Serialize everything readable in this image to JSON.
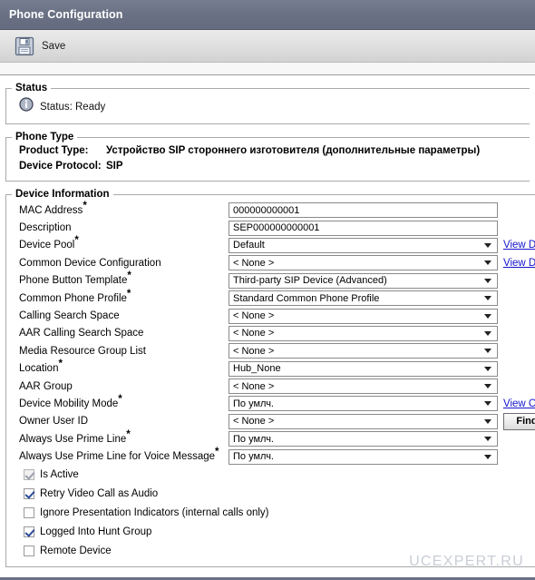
{
  "window": {
    "title": "Phone Configuration"
  },
  "toolbar": {
    "save_label": "Save",
    "save_icon": "floppy-disk-icon"
  },
  "status": {
    "legend": "Status",
    "icon": "info-icon",
    "text": "Status: Ready"
  },
  "phone_type": {
    "legend": "Phone Type",
    "rows": [
      {
        "key": "Product Type:",
        "value": "Устройство SIP стороннего изготовителя (дополнительные параметры)"
      },
      {
        "key": "Device Protocol:",
        "value": "SIP"
      }
    ]
  },
  "device_information": {
    "legend": "Device Information",
    "fields": [
      {
        "label": "MAC Address",
        "required": true,
        "type": "text",
        "value": "000000000001"
      },
      {
        "label": "Description",
        "required": false,
        "type": "text",
        "value": "SEP000000000001"
      },
      {
        "label": "Device Pool",
        "required": true,
        "type": "select",
        "value": "Default",
        "link": "View Details"
      },
      {
        "label": "Common Device Configuration",
        "required": false,
        "type": "select",
        "value": "< None >",
        "link": "View Details"
      },
      {
        "label": "Phone Button Template",
        "required": true,
        "type": "select",
        "value": "Third-party SIP Device (Advanced)"
      },
      {
        "label": "Common Phone Profile",
        "required": true,
        "type": "select",
        "value": "Standard Common Phone Profile"
      },
      {
        "label": "Calling Search Space",
        "required": false,
        "type": "select",
        "value": "< None >"
      },
      {
        "label": "AAR Calling Search Space",
        "required": false,
        "type": "select",
        "value": "< None >"
      },
      {
        "label": "Media Resource Group List",
        "required": false,
        "type": "select",
        "value": "< None >"
      },
      {
        "label": "Location",
        "required": true,
        "type": "select",
        "value": "Hub_None"
      },
      {
        "label": "AAR Group",
        "required": false,
        "type": "select",
        "value": "< None >"
      },
      {
        "label": "Device Mobility Mode",
        "required": true,
        "type": "select",
        "value": "По умлч.",
        "link": "View Current Device Mobility Settings"
      },
      {
        "label": "Owner User ID",
        "required": false,
        "type": "select",
        "value": "< None >",
        "button": "Find"
      },
      {
        "label": "Always Use Prime Line",
        "required": true,
        "type": "select",
        "value": "По умлч."
      },
      {
        "label": "Always Use Prime Line for Voice Message",
        "required": true,
        "type": "select",
        "value": "По умлч."
      }
    ],
    "checkboxes": [
      {
        "label": "Is Active",
        "checked": true,
        "disabled": true
      },
      {
        "label": "Retry Video Call as Audio",
        "checked": true,
        "disabled": false
      },
      {
        "label": "Ignore Presentation Indicators (internal calls only)",
        "checked": false,
        "disabled": false
      },
      {
        "label": "Logged Into Hunt Group",
        "checked": true,
        "disabled": false
      },
      {
        "label": "Remote Device",
        "checked": false,
        "disabled": false
      }
    ]
  },
  "watermark": {
    "text": "UCEXPERT.RU"
  },
  "colors": {
    "titlebar": "#6a7184",
    "link": "#1414cc",
    "watermark": "#c8cdd6"
  }
}
